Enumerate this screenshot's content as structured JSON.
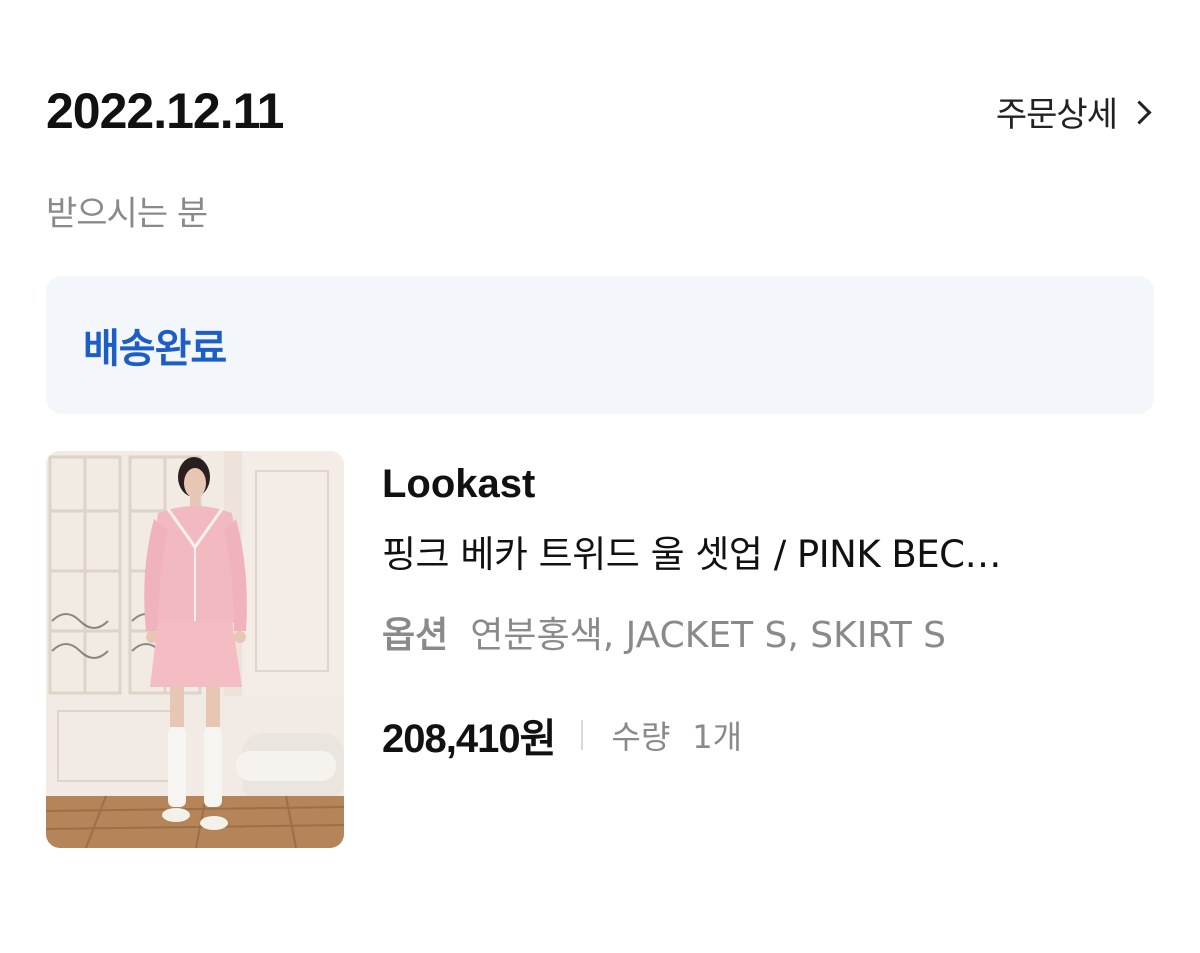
{
  "order": {
    "date": "2022.12.11",
    "detail_link_label": "주문상세"
  },
  "recipient": {
    "label": "받으시는 분"
  },
  "status": {
    "text": "배송완료",
    "color": "#1d5ec6",
    "background": "#f3f6fa"
  },
  "product": {
    "brand": "Lookast",
    "name": "핑크 베카 트위드 울 셋업 / PINK BEC…",
    "option_label": "옵션",
    "option_value": "연분홍색, JACKET S, SKIRT S",
    "price": "208,410원",
    "quantity_label": "수량",
    "quantity_value": "1개"
  },
  "icons": {
    "detail_chevron": "chevron-right-icon"
  }
}
